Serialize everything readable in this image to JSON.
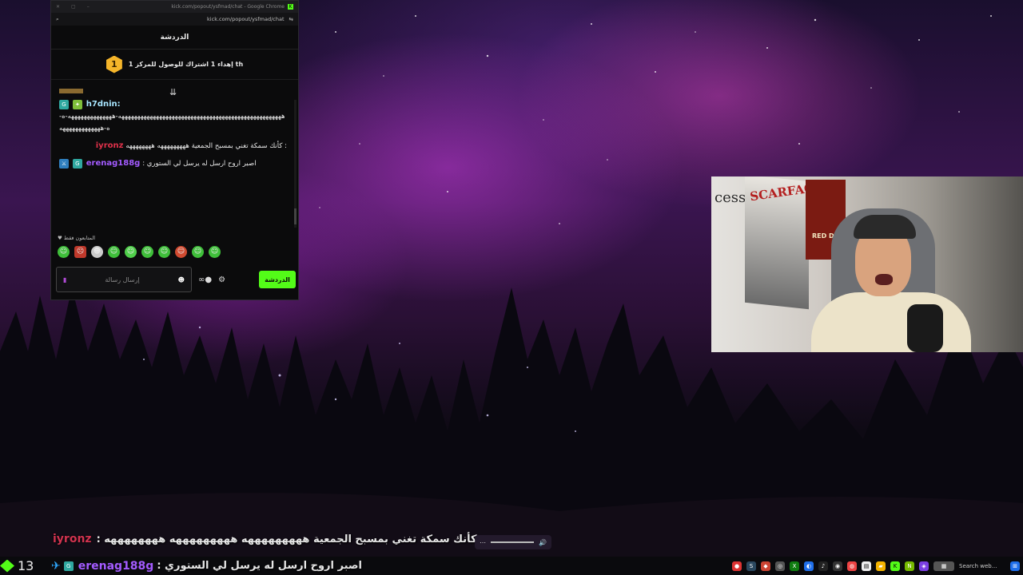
{
  "window": {
    "title": "kick.com/popout/ysfmad/chat - Google Chrome",
    "url": "kick.com/popout/ysfmad/chat"
  },
  "chat": {
    "header": "الدردشة",
    "promo_text": "إهداء 1 اشتراك للوصول للمركز 1 th",
    "promo_rank": "1",
    "messages": [
      {
        "username": "h7dnin:",
        "username_color": "#a8e6ff",
        "text": "ههههههههههههههههههههههههههههههههههههههههههههههههههههه-ههههههههههههههه-ه-ه-هههههههههههههه"
      },
      {
        "username": "iyronz",
        "username_color": "#e0314a",
        "text": ": كأنك سمكة تغني بمسبح الجمعية هههههههههه ههههههههه"
      },
      {
        "username": "erenag188g",
        "username_color": "#a35bff",
        "text": ": اصبر اروح ارسل له يرسل لي الستوري"
      }
    ],
    "emotes_label": "المتابعون فقط",
    "input_placeholder": "إرسال رسالة",
    "send_label": "الدردشة"
  },
  "overlay": {
    "line1_username": "iyronz",
    "line1_text": ": كأنك سمكة تغني بمسبح الجمعية هههههههههه هههههههههه ههههههههه",
    "line2_username": "erenag188g",
    "line2_text": ": اصبر اروح ارسل له يرسل لي الستوري",
    "viewer_count": "13"
  },
  "webcam": {
    "wall_text": "cess",
    "poster_title": "SCARFACE",
    "poster2_title": "RED DEAD"
  },
  "taskbar": {
    "search_placeholder": "Search web..."
  },
  "colors": {
    "kick_green": "#53fc18",
    "accent_purple": "#a35bff",
    "accent_red": "#e0314a"
  },
  "icons": [
    "search-icon",
    "settings-icon",
    "emoji-icon",
    "mic-icon",
    "gear-icon",
    "infinity-icon",
    "rank-icon",
    "volume-icon"
  ]
}
